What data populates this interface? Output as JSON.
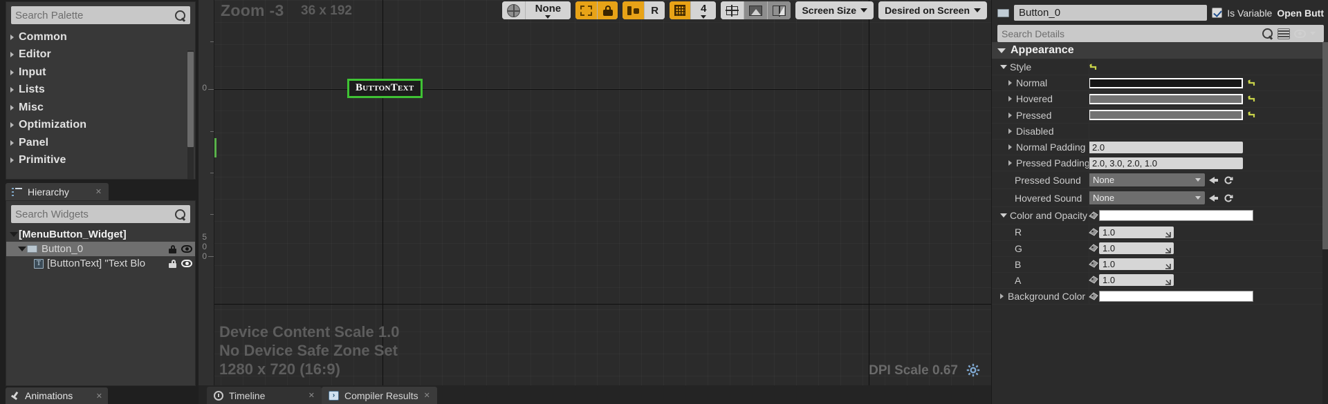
{
  "palette": {
    "search_placeholder": "Search Palette",
    "categories": [
      {
        "label": "Common"
      },
      {
        "label": "Editor"
      },
      {
        "label": "Input"
      },
      {
        "label": "Lists"
      },
      {
        "label": "Misc"
      },
      {
        "label": "Optimization"
      },
      {
        "label": "Panel"
      },
      {
        "label": "Primitive"
      }
    ]
  },
  "hierarchy": {
    "tab_label": "Hierarchy",
    "search_placeholder": "Search Widgets",
    "tree": [
      {
        "label": "[MenuButton_Widget]",
        "depth": 0,
        "selected": false,
        "icons": false
      },
      {
        "label": "Button_0",
        "depth": 1,
        "selected": true,
        "icons": true
      },
      {
        "label": "[ButtonText] \"Text Blo",
        "depth": 2,
        "selected": false,
        "icons": true
      }
    ]
  },
  "animations": {
    "tab_label": "Animations"
  },
  "viewport": {
    "zoom_label": "Zoom -3",
    "size_label": "36 x 192",
    "ruler_zero": "0",
    "ruler_marks": [
      "5",
      "0",
      "0"
    ],
    "button_text": "ButtonText",
    "device_content_scale": "Device Content Scale 1.0",
    "safe_zone": "No Device Safe Zone Set",
    "resolution": "1280 x 720 (16:9)",
    "dpi_scale": "DPI Scale 0.67",
    "toolbar": {
      "none_label": "None",
      "rotation_label": "R",
      "grid_snap_value": "4",
      "screen_size_label": "Screen Size",
      "fill_label": "Desired on Screen"
    },
    "bottom_tabs": [
      {
        "label": "Timeline",
        "active": false
      },
      {
        "label": "Compiler Results",
        "active": true
      }
    ]
  },
  "details": {
    "widget_name": "Button_0",
    "is_variable_label": "Is Variable",
    "open_button_label": "Open Butt",
    "search_placeholder": "Search Details",
    "category": "Appearance",
    "rows": [
      {
        "name": "Style",
        "indent": 1,
        "tri": "open",
        "type": "revert-only"
      },
      {
        "name": "Normal",
        "indent": 2,
        "tri": "closed",
        "type": "swatch",
        "swatch": "dark",
        "revert": true
      },
      {
        "name": "Hovered",
        "indent": 2,
        "tri": "closed",
        "type": "swatch",
        "swatch": "gray",
        "revert": true
      },
      {
        "name": "Pressed",
        "indent": 2,
        "tri": "closed",
        "type": "swatch",
        "swatch": "gray",
        "revert": true
      },
      {
        "name": "Disabled",
        "indent": 2,
        "tri": "closed",
        "type": "empty"
      },
      {
        "name": "Normal Padding",
        "indent": 2,
        "tri": "closed",
        "type": "text",
        "value": "2.0"
      },
      {
        "name": "Pressed Padding",
        "indent": 2,
        "tri": "closed",
        "type": "text",
        "value": "2.0, 3.0, 2.0, 1.0"
      },
      {
        "name": "Pressed Sound",
        "indent": 3,
        "tri": "none",
        "type": "object",
        "value": "None"
      },
      {
        "name": "Hovered Sound",
        "indent": 3,
        "tri": "none",
        "type": "object",
        "value": "None"
      },
      {
        "name": "Color and Opacity",
        "indent": 1,
        "tri": "open",
        "type": "swatch",
        "swatch": "white",
        "bind": true
      },
      {
        "name": "R",
        "indent": 3,
        "tri": "none",
        "type": "num",
        "value": "1.0",
        "bind": true
      },
      {
        "name": "G",
        "indent": 3,
        "tri": "none",
        "type": "num",
        "value": "1.0",
        "bind": true
      },
      {
        "name": "B",
        "indent": 3,
        "tri": "none",
        "type": "num",
        "value": "1.0",
        "bind": true
      },
      {
        "name": "A",
        "indent": 3,
        "tri": "none",
        "type": "num",
        "value": "1.0",
        "bind": true
      },
      {
        "name": "Background Color",
        "indent": 1,
        "tri": "closed",
        "type": "swatch",
        "swatch": "white",
        "bind": true
      }
    ]
  },
  "colors": {
    "accent_orange": "#e8a317",
    "selection_green": "#3fc234",
    "panel_bg": "#383838",
    "app_bg": "#242424"
  }
}
